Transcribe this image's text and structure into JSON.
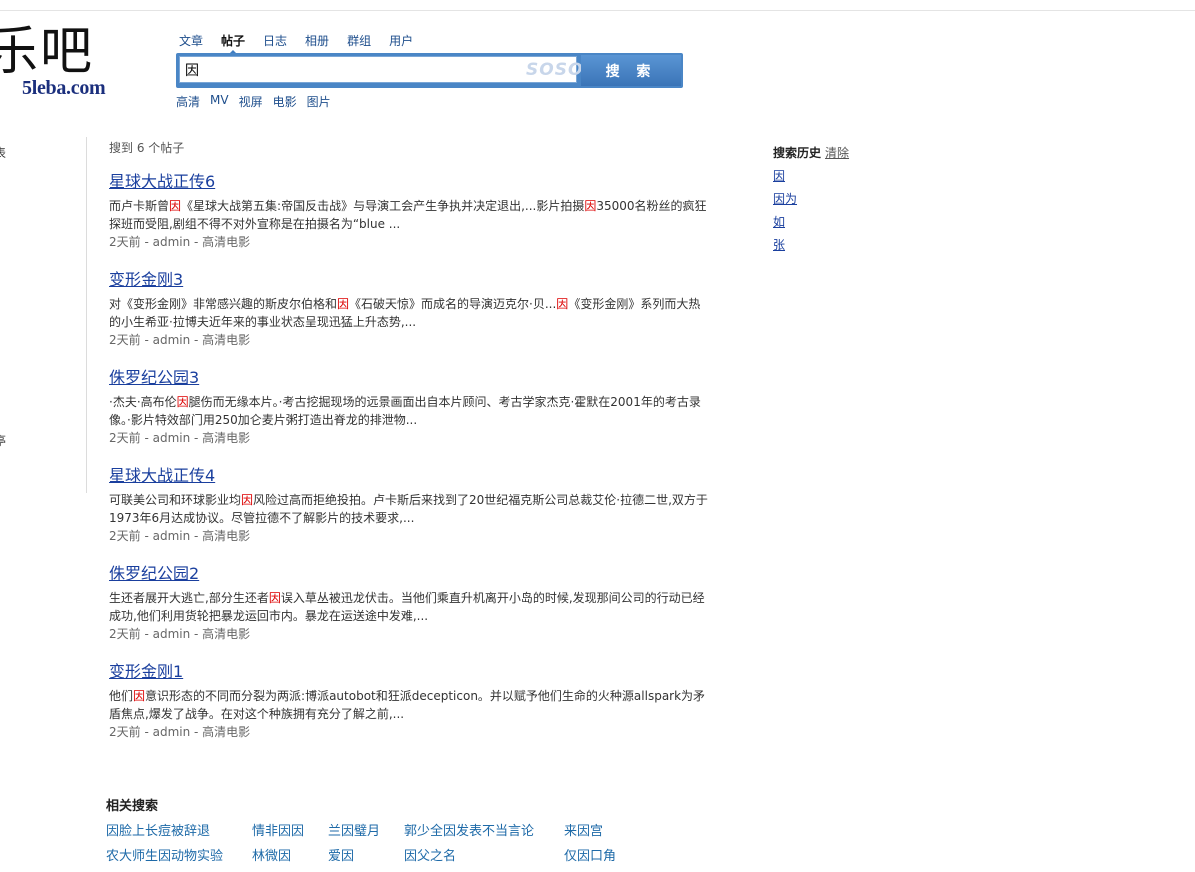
{
  "logo": {
    "chinese": "乐吧",
    "domain": "5leba.com"
  },
  "tabs": [
    {
      "label": "文章",
      "active": false
    },
    {
      "label": "帖子",
      "active": true
    },
    {
      "label": "日志",
      "active": false
    },
    {
      "label": "相册",
      "active": false
    },
    {
      "label": "群组",
      "active": false
    },
    {
      "label": "用户",
      "active": false
    }
  ],
  "search": {
    "query": "因",
    "watermark": "SOSO",
    "button_label": "搜 索"
  },
  "subtabs": [
    "高清",
    "MV",
    "视屏",
    "电影",
    "图片"
  ],
  "left_sidebar_fragments": [
    "表",
    "亭"
  ],
  "results_count": "搜到 6 个帖子",
  "results": [
    {
      "title": "星球大战正传6",
      "snippet": [
        "而卢卡斯曾",
        "因",
        "《星球大战第五集:帝国反击战》与导演工会产生争执并决定退出,...影片拍摄",
        "因",
        "35000名粉丝的疯狂探班而受阻,剧组不得不对外宣称是在拍摄名为“blue ..."
      ],
      "meta": "2天前 - admin - 高清电影"
    },
    {
      "title": "变形金刚3",
      "snippet": [
        "对《变形金刚》非常感兴趣的斯皮尔伯格和",
        "因",
        "《石破天惊》而成名的导演迈克尔·贝...",
        "因",
        "《变形金刚》系列而大热的小生希亚·拉博夫近年来的事业状态呈现迅猛上升态势,..."
      ],
      "meta": "2天前 - admin - 高清电影"
    },
    {
      "title": "侏罗纪公园3",
      "snippet": [
        "·杰夫·高布伦",
        "因",
        "腿伤而无缘本片。·考古挖掘现场的远景画面出自本片顾问、考古学家杰克·霍默在2001年的考古录像。·影片特效部门用250加仑麦片粥打造出脊龙的排泄物..."
      ],
      "meta": "2天前 - admin - 高清电影"
    },
    {
      "title": "星球大战正传4",
      "snippet": [
        "可联美公司和环球影业均",
        "因",
        "风险过高而拒绝投拍。卢卡斯后来找到了20世纪福克斯公司总裁艾伦·拉德二世,双方于1973年6月达成协议。尽管拉德不了解影片的技术要求,..."
      ],
      "meta": "2天前 - admin - 高清电影"
    },
    {
      "title": "侏罗纪公园2",
      "snippet": [
        "生还者展开大逃亡,部分生还者",
        "因",
        "误入草丛被迅龙伏击。当他们乘直升机离开小岛的时候,发现那间公司的行动已经成功,他们利用货轮把暴龙运回市内。暴龙在运送途中发难,..."
      ],
      "meta": "2天前 - admin - 高清电影"
    },
    {
      "title": "变形金刚1",
      "snippet": [
        "他们",
        "因",
        "意识形态的不同而分裂为两派:博派autobot和狂派decepticon。并以赋予他们生命的火种源allspark为矛盾焦点,爆发了战争。在对这个种族拥有充分了解之前,..."
      ],
      "meta": "2天前 - admin - 高清电影"
    }
  ],
  "history": {
    "title": "搜索历史",
    "clear_label": "清除",
    "items": [
      "因",
      "因为",
      "如",
      "张"
    ]
  },
  "related": {
    "title": "相关搜索",
    "rows": [
      [
        "因脸上长痘被辞退",
        "情非因因",
        "兰因璧月",
        "郭少全因发表不当言论",
        "来因宫"
      ],
      [
        "农大师生因动物实验",
        "林微因",
        "爱因",
        "因父之名",
        "仅因口角"
      ]
    ]
  }
}
